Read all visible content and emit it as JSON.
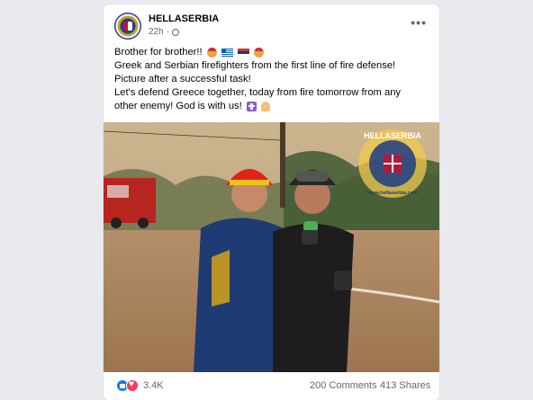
{
  "post": {
    "page_name": "HELLASERBIA",
    "time": "22h",
    "dot": "·",
    "more": "•••",
    "line1": "Brother for brother!!",
    "line2": "Greek and Serbian firefighters from the first line of fire defense!",
    "line3": "Picture after a successful task!",
    "line4": "Let's defend Greece together, today from fire tomorrow from any",
    "line5": "other enemy! God is with us!"
  },
  "photo": {
    "watermark_title": "HELLASERBIA",
    "watermark_url": "www.hellaserbia.com"
  },
  "engagement": {
    "reactions": "3.4K",
    "comments": "200 Comments",
    "shares": "413 Shares"
  },
  "icons": {
    "reactions": [
      "like-icon",
      "love-icon"
    ],
    "privacy": "globe-icon",
    "more": "more-icon"
  },
  "colors": {
    "accent": "#1877f2",
    "love": "#f33e58",
    "meta_text": "#65676b"
  }
}
